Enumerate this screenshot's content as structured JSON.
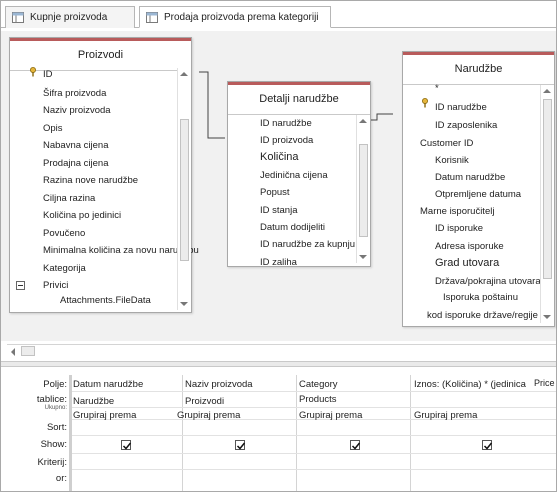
{
  "tabs": [
    {
      "label": "Kupnje proizvoda",
      "active": false
    },
    {
      "label": "Prodaja proizvoda prema kategoriji",
      "active": true
    }
  ],
  "tables": {
    "proizvodi": {
      "title": "Proizvodi",
      "fields": [
        "ID",
        "Šifra proizvoda",
        "Naziv proizvoda",
        "Opis",
        "Nabavna cijena",
        "Prodajna cijena",
        "Razina nove narudžbe",
        "Ciljna razina",
        "Količina po jedinici",
        "Povučeno",
        "Minimalna količina za novu narudžbu",
        "Kategorija",
        "Privici",
        "Attachments.FileData"
      ]
    },
    "detalji": {
      "title": "Detalji narudžbe",
      "fields": [
        "ID narudžbe",
        "ID proizvoda",
        "Količina",
        "Jedinična cijena",
        "Popust",
        "ID stanja",
        "Datum dodijeliti",
        "ID narudžbe za kupnju",
        "ID zaliha"
      ]
    },
    "narudzbe": {
      "title": "Narudžbe",
      "fields": [
        "*",
        "ID narudžbe",
        "ID zaposlenika",
        "Customer ID",
        "Korisnik",
        "Datum narudžbe",
        "Otpremljene datuma",
        "Marne isporučitelj",
        "ID isporuke",
        "Adresa isporuke",
        "Grad utovara",
        "Država/pokrajina utovara",
        "Isporuka poštainu",
        "kod isporuke države/regije"
      ]
    }
  },
  "grid": {
    "row_labels": {
      "field": "Polje:",
      "table": "tablice:",
      "total": "Ukupno:",
      "sort": "Sort:",
      "show": "Show:",
      "criteria": "Kriterij:",
      "or": "or:"
    },
    "columns": [
      {
        "field": "Datum narudžbe",
        "table": "Narudžbe",
        "total": "Grupiraj prema",
        "show": true
      },
      {
        "field": "Naziv proizvoda",
        "table": "Proizvodi",
        "total": "Grupiraj prema",
        "show": true
      },
      {
        "field": "Category",
        "table": "Products",
        "total": "Grupiraj prema",
        "show": true
      },
      {
        "field": "Iznos: (Količina) * (jedinica",
        "field_extra": "Price",
        "table": "",
        "total": "Grupiraj prema",
        "show": true
      }
    ]
  },
  "colors": {
    "table_header_accent": "#b85b5b",
    "canvas_bg": "#f1f1f1"
  },
  "icons": [
    "table-icon",
    "query-icon",
    "key-icon",
    "expand-icon",
    "check-icon"
  ]
}
